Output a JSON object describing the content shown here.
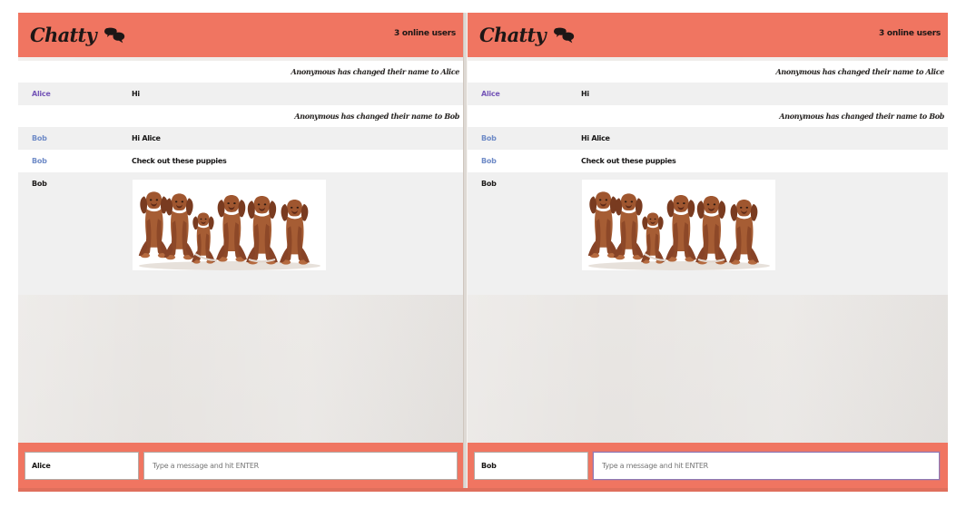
{
  "colors": {
    "brand_coral": "#f07561",
    "page_background": "#ffffff",
    "message_area": "#ece9e6",
    "alice_name": "#7657b8",
    "bob_name": "#6f8bc7",
    "default_text": "#1c1a19"
  },
  "icons": {
    "header_logo": "chat-bubbles-icon",
    "puppy_image": "puppies-image"
  },
  "panels": [
    {
      "header": {
        "title": "Chatty",
        "online_users": "3 online users"
      },
      "messages": [
        {
          "type": "system",
          "text": "Anonymous has changed their name to Alice"
        },
        {
          "type": "message",
          "username": "Alice",
          "content": "Hi"
        },
        {
          "type": "system",
          "text": "Anonymous has changed their name to Bob"
        },
        {
          "type": "message",
          "username": "Bob",
          "content": "Hi Alice"
        },
        {
          "type": "message",
          "username": "Bob",
          "content": "Check out these puppies"
        },
        {
          "type": "image",
          "username": "Bob",
          "image": "puppies"
        }
      ],
      "composer": {
        "name_value": "Alice",
        "message_placeholder": "Type a message and hit ENTER"
      }
    },
    {
      "header": {
        "title": "Chatty",
        "online_users": "3 online users"
      },
      "messages": [
        {
          "type": "system",
          "text": "Anonymous has changed their name to Alice"
        },
        {
          "type": "message",
          "username": "Alice",
          "content": "Hi"
        },
        {
          "type": "system",
          "text": "Anonymous has changed their name to Bob"
        },
        {
          "type": "message",
          "username": "Bob",
          "content": "Hi Alice"
        },
        {
          "type": "message",
          "username": "Bob",
          "content": "Check out these puppies"
        },
        {
          "type": "image",
          "username": "Bob",
          "image": "puppies"
        }
      ],
      "composer": {
        "name_value": "Bob",
        "message_placeholder": "Type a message and hit ENTER"
      }
    }
  ]
}
